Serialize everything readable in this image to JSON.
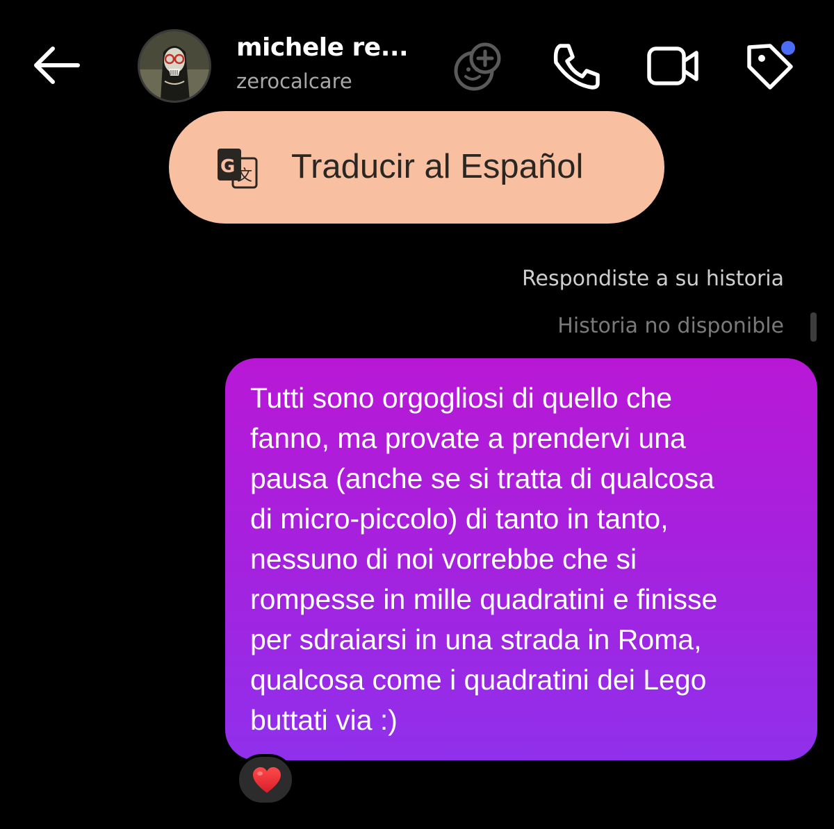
{
  "header": {
    "contact_name": "michele re...",
    "contact_username": "zerocalcare",
    "icons": [
      "back-arrow-icon",
      "add-emoji-icon",
      "phone-icon",
      "video-camera-icon",
      "tag-icon"
    ],
    "notification_dot_color": "#4a6cf7"
  },
  "translate": {
    "label": "Traducir al Español",
    "icon": "translate-icon",
    "background": "#f8bfa0"
  },
  "thread": {
    "reply_note": "Respondiste a su historia",
    "story_status": "Historia no disponible",
    "message": {
      "text": "Tutti sono orgogliosi di quello che\nfanno, ma provate a prendervi una\npausa (anche se si tratta di qualcosa\ndi micro-piccolo) di tanto in tanto,\nnessuno di noi vorrebbe che si\nrompesse in mille quadratini e finisse\nper sdraiarsi in una strada in Roma,\nqualcosa come i quadratini dei Lego\nbuttati via :)",
      "gradient_top": "#b818d6",
      "gradient_bottom": "#9030ec",
      "reaction": "heart-icon"
    }
  }
}
